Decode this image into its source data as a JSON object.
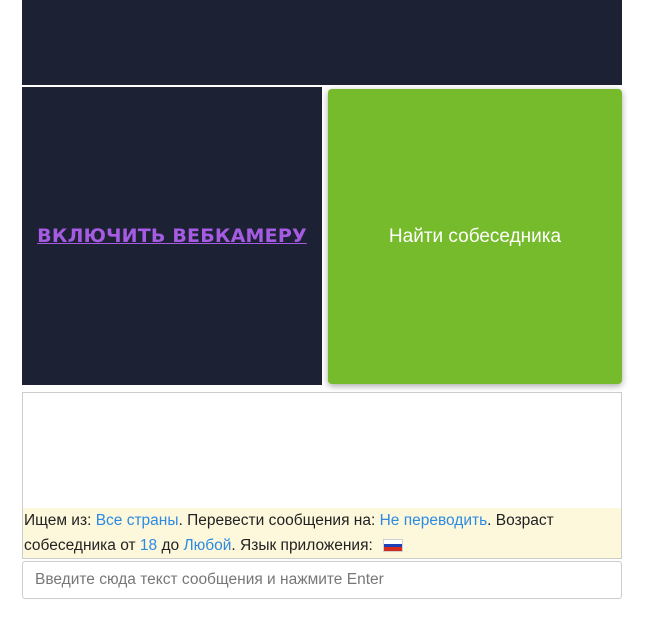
{
  "video": {
    "webcam_label": "ВКЛЮЧИТЬ ВЕБКАМЕРУ",
    "find_label": "Найти собеседника"
  },
  "info": {
    "search_from_label": "Ищем из:",
    "search_from_value": "Все страны",
    "translate_label": ". Перевести сообщения на:",
    "translate_value": "Не переводить",
    "age_label": ". Возраст собеседника от",
    "age_from": "18",
    "age_to_label": "до",
    "age_to": "Любой",
    "lang_label": ". Язык приложения:",
    "lang_flag_icon": "russia-flag-icon"
  },
  "message": {
    "placeholder": "Введите сюда текст сообщения и нажмите Enter"
  },
  "colors": {
    "video_bg": "#1c2134",
    "find_button": "#76bb2b",
    "webcam_link": "#a55be2",
    "link": "#2b8ae2",
    "info_bg": "#fdf7dc",
    "flag_white": "#ffffff",
    "flag_blue": "#1d3fb8",
    "flag_red": "#d52b1e"
  }
}
